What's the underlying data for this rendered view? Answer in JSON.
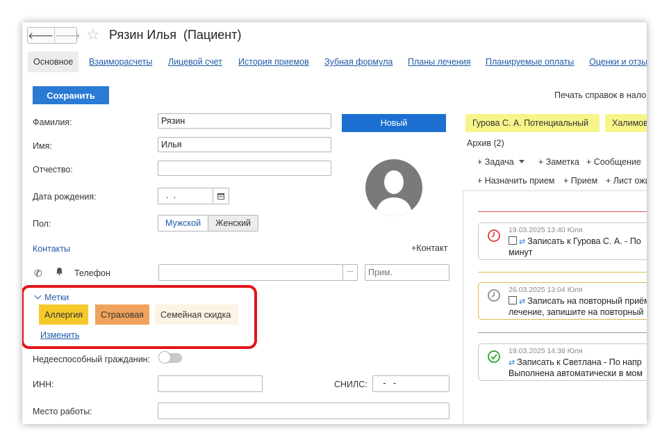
{
  "window": {
    "nav_back": "🡐",
    "nav_forward": "🡒",
    "title": "Рязин Илья  (Пациент)"
  },
  "tabs": [
    {
      "label": "Основное",
      "active": true
    },
    {
      "label": "Взаиморасчеты"
    },
    {
      "label": "Лицевой счет"
    },
    {
      "label": "История приемов"
    },
    {
      "label": "Зубная формула"
    },
    {
      "label": "Планы лечения"
    },
    {
      "label": "Планируемые оплаты"
    },
    {
      "label": "Оценки и отзывы"
    }
  ],
  "toolbar": {
    "save_label": "Сохранить",
    "print_label": "Печать справок в налоговую"
  },
  "form": {
    "last_name_label": "Фамилия:",
    "last_name_value": "Рязин",
    "first_name_label": "Имя:",
    "first_name_value": "Илья",
    "middle_name_label": "Отчество:",
    "middle_name_value": "",
    "birth_label": "Дата рождения:",
    "birth_value": "  .  .",
    "gender_label": "Пол:",
    "gender_male": "Мужской",
    "gender_female": "Женский",
    "new_button": "Новый",
    "contacts_label": "Контакты",
    "add_contact": "+Контакт",
    "phone_label": "Телефон",
    "phone_value": "",
    "phone_more": "...",
    "phone_note_placeholder": "Прим.",
    "tags_label": "Метки",
    "tags": [
      {
        "label": "Аллергия",
        "color": "#f6c92b"
      },
      {
        "label": "Страховая",
        "color": "#f0a35c"
      },
      {
        "label": "Семейная скидка",
        "color": "#fbf3e4"
      }
    ],
    "tags_change": "Изменить",
    "incapable_label": "Недееспособный гражданин:",
    "inn_label": "ИНН:",
    "inn_value": "",
    "snils_label": "СНИЛС:",
    "snils_value": "   -   -",
    "work_label": "Место работы:",
    "work_value": ""
  },
  "right": {
    "chips": [
      "Гурова С. А.    Потенциальный",
      "Халимова"
    ],
    "archive": "Архив (2)",
    "actions_row1": [
      "+ Задача",
      "+ Заметка",
      "+ Сообщение"
    ],
    "actions_row2": [
      "+ Назначить прием",
      "+ Прием",
      "+ Лист ожидания"
    ],
    "cards": [
      {
        "meta": "19.03.2025 13:40 Юля",
        "line1": "Записать к Гурова С. А. - По",
        "line2": "минут",
        "status": "overdue",
        "color": "#e03b3b"
      },
      {
        "meta": "26.03.2025 13:04 Юля",
        "line1": "Записать на повторный приём",
        "line2": "лечение, запишите на повторный",
        "status": "pending",
        "color": "#8a8a8a"
      },
      {
        "meta": "19.03.2025 14:38 Юля",
        "line1": "Записать к Светлана - По напр",
        "line2": "Выполнена автоматически в мом",
        "status": "done",
        "color": "#2aa52a"
      }
    ]
  },
  "colors": {
    "accent": "#2b7ad4",
    "link": "#1f5ba8",
    "highlight_frame": "#e3131b",
    "chip": "#f7f48a"
  }
}
